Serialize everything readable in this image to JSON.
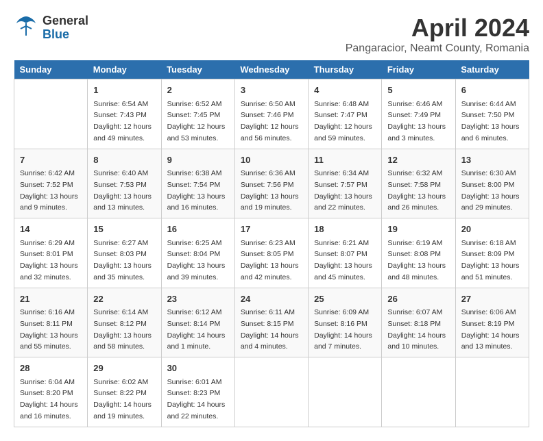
{
  "logo": {
    "general": "General",
    "blue": "Blue"
  },
  "title": "April 2024",
  "subtitle": "Pangaracior, Neamt County, Romania",
  "days_of_week": [
    "Sunday",
    "Monday",
    "Tuesday",
    "Wednesday",
    "Thursday",
    "Friday",
    "Saturday"
  ],
  "weeks": [
    [
      {
        "day": "",
        "info": ""
      },
      {
        "day": "1",
        "info": "Sunrise: 6:54 AM\nSunset: 7:43 PM\nDaylight: 12 hours\nand 49 minutes."
      },
      {
        "day": "2",
        "info": "Sunrise: 6:52 AM\nSunset: 7:45 PM\nDaylight: 12 hours\nand 53 minutes."
      },
      {
        "day": "3",
        "info": "Sunrise: 6:50 AM\nSunset: 7:46 PM\nDaylight: 12 hours\nand 56 minutes."
      },
      {
        "day": "4",
        "info": "Sunrise: 6:48 AM\nSunset: 7:47 PM\nDaylight: 12 hours\nand 59 minutes."
      },
      {
        "day": "5",
        "info": "Sunrise: 6:46 AM\nSunset: 7:49 PM\nDaylight: 13 hours\nand 3 minutes."
      },
      {
        "day": "6",
        "info": "Sunrise: 6:44 AM\nSunset: 7:50 PM\nDaylight: 13 hours\nand 6 minutes."
      }
    ],
    [
      {
        "day": "7",
        "info": "Sunrise: 6:42 AM\nSunset: 7:52 PM\nDaylight: 13 hours\nand 9 minutes."
      },
      {
        "day": "8",
        "info": "Sunrise: 6:40 AM\nSunset: 7:53 PM\nDaylight: 13 hours\nand 13 minutes."
      },
      {
        "day": "9",
        "info": "Sunrise: 6:38 AM\nSunset: 7:54 PM\nDaylight: 13 hours\nand 16 minutes."
      },
      {
        "day": "10",
        "info": "Sunrise: 6:36 AM\nSunset: 7:56 PM\nDaylight: 13 hours\nand 19 minutes."
      },
      {
        "day": "11",
        "info": "Sunrise: 6:34 AM\nSunset: 7:57 PM\nDaylight: 13 hours\nand 22 minutes."
      },
      {
        "day": "12",
        "info": "Sunrise: 6:32 AM\nSunset: 7:58 PM\nDaylight: 13 hours\nand 26 minutes."
      },
      {
        "day": "13",
        "info": "Sunrise: 6:30 AM\nSunset: 8:00 PM\nDaylight: 13 hours\nand 29 minutes."
      }
    ],
    [
      {
        "day": "14",
        "info": "Sunrise: 6:29 AM\nSunset: 8:01 PM\nDaylight: 13 hours\nand 32 minutes."
      },
      {
        "day": "15",
        "info": "Sunrise: 6:27 AM\nSunset: 8:03 PM\nDaylight: 13 hours\nand 35 minutes."
      },
      {
        "day": "16",
        "info": "Sunrise: 6:25 AM\nSunset: 8:04 PM\nDaylight: 13 hours\nand 39 minutes."
      },
      {
        "day": "17",
        "info": "Sunrise: 6:23 AM\nSunset: 8:05 PM\nDaylight: 13 hours\nand 42 minutes."
      },
      {
        "day": "18",
        "info": "Sunrise: 6:21 AM\nSunset: 8:07 PM\nDaylight: 13 hours\nand 45 minutes."
      },
      {
        "day": "19",
        "info": "Sunrise: 6:19 AM\nSunset: 8:08 PM\nDaylight: 13 hours\nand 48 minutes."
      },
      {
        "day": "20",
        "info": "Sunrise: 6:18 AM\nSunset: 8:09 PM\nDaylight: 13 hours\nand 51 minutes."
      }
    ],
    [
      {
        "day": "21",
        "info": "Sunrise: 6:16 AM\nSunset: 8:11 PM\nDaylight: 13 hours\nand 55 minutes."
      },
      {
        "day": "22",
        "info": "Sunrise: 6:14 AM\nSunset: 8:12 PM\nDaylight: 13 hours\nand 58 minutes."
      },
      {
        "day": "23",
        "info": "Sunrise: 6:12 AM\nSunset: 8:14 PM\nDaylight: 14 hours\nand 1 minute."
      },
      {
        "day": "24",
        "info": "Sunrise: 6:11 AM\nSunset: 8:15 PM\nDaylight: 14 hours\nand 4 minutes."
      },
      {
        "day": "25",
        "info": "Sunrise: 6:09 AM\nSunset: 8:16 PM\nDaylight: 14 hours\nand 7 minutes."
      },
      {
        "day": "26",
        "info": "Sunrise: 6:07 AM\nSunset: 8:18 PM\nDaylight: 14 hours\nand 10 minutes."
      },
      {
        "day": "27",
        "info": "Sunrise: 6:06 AM\nSunset: 8:19 PM\nDaylight: 14 hours\nand 13 minutes."
      }
    ],
    [
      {
        "day": "28",
        "info": "Sunrise: 6:04 AM\nSunset: 8:20 PM\nDaylight: 14 hours\nand 16 minutes."
      },
      {
        "day": "29",
        "info": "Sunrise: 6:02 AM\nSunset: 8:22 PM\nDaylight: 14 hours\nand 19 minutes."
      },
      {
        "day": "30",
        "info": "Sunrise: 6:01 AM\nSunset: 8:23 PM\nDaylight: 14 hours\nand 22 minutes."
      },
      {
        "day": "",
        "info": ""
      },
      {
        "day": "",
        "info": ""
      },
      {
        "day": "",
        "info": ""
      },
      {
        "day": "",
        "info": ""
      }
    ]
  ]
}
